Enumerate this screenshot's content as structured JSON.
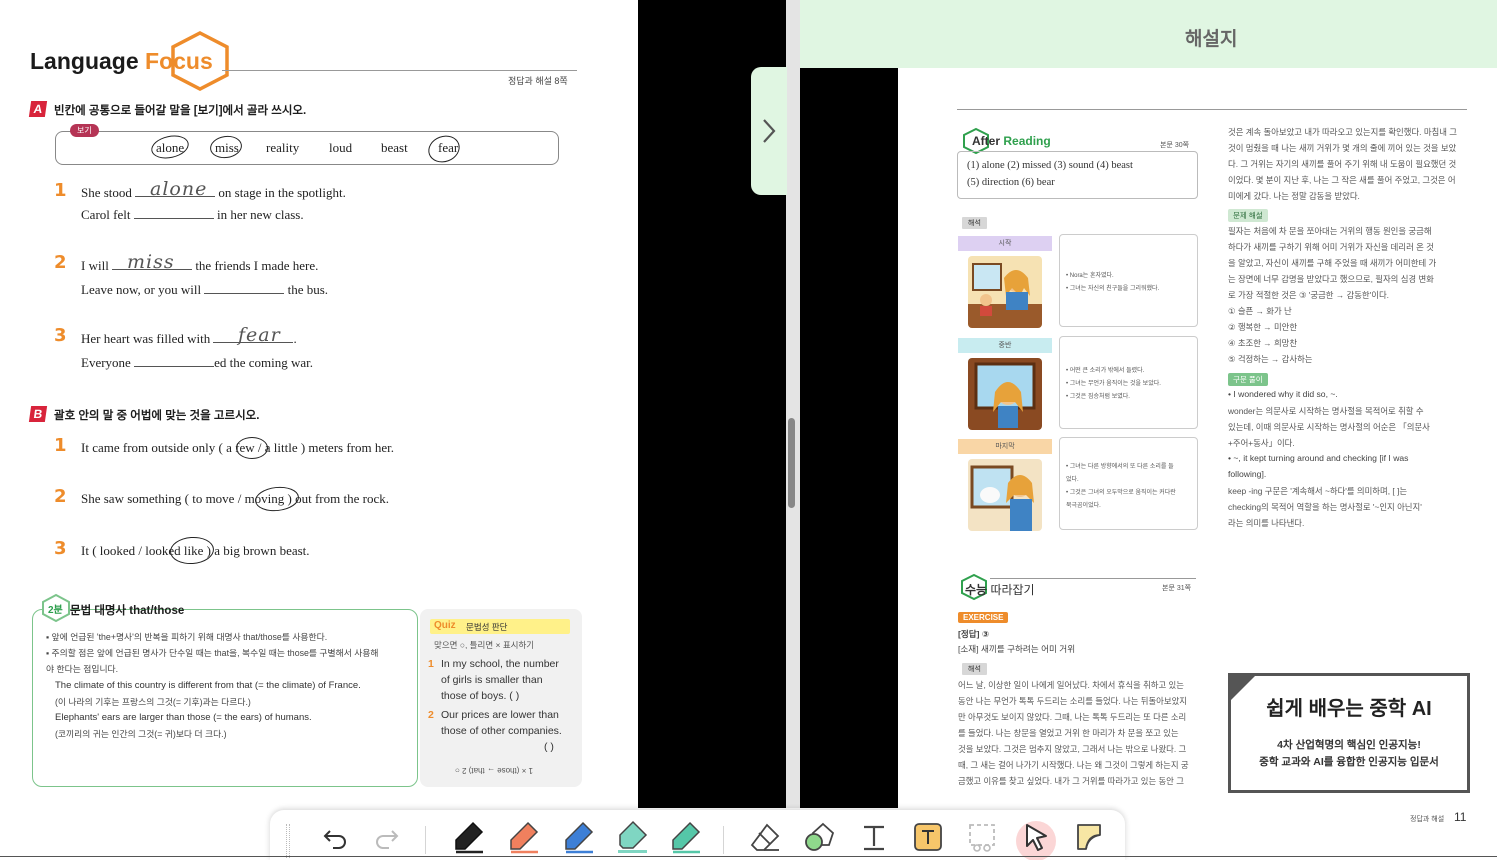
{
  "left_page": {
    "title_word1": "Language",
    "title_word2": "Focus",
    "page_ref": "정답과 해설 8쪽",
    "section_a": {
      "badge": "A",
      "instruction": "빈칸에 공통으로 들어갈 말을 [보기]에서 골라 쓰시오.",
      "word_box_tag": "보기",
      "words": [
        "alone",
        "miss",
        "reality",
        "loud",
        "beast",
        "fear"
      ],
      "questions": [
        {
          "num": "1",
          "line1_pre": "She stood",
          "answer": "alone",
          "line1_post": "on stage in the spotlight.",
          "line2_pre": "Carol felt",
          "line2_post": "in her new class."
        },
        {
          "num": "2",
          "line1_pre": "I will",
          "answer": "miss",
          "line1_post": "the friends I made here.",
          "line2_pre": "Leave now, or you will",
          "line2_post": "the bus."
        },
        {
          "num": "3",
          "line1_pre": "Her heart was filled with",
          "answer": "fear",
          "line1_post": ".",
          "line2_pre": "Everyone",
          "line2_post": "ed the coming war."
        }
      ]
    },
    "section_b": {
      "badge": "B",
      "instruction": "괄호 안의 말 중 어법에 맞는 것을 고르시오.",
      "questions": [
        {
          "num": "1",
          "text": "It came from outside only ( a few / a little ) meters from her."
        },
        {
          "num": "2",
          "text": "She saw something ( to move / moving ) out from the rock."
        },
        {
          "num": "3",
          "text": "It ( looked / looked like ) a big brown beast."
        }
      ]
    },
    "grammar": {
      "num": "2분",
      "title": "문법   대명사 that/those",
      "lines": [
        "▪ 앞에 언급된 'the+명사'의 반복을 피하기 위해 대명사 that/those를 사용한다.",
        "▪ 주의할 점은 앞에 언급된 명사가 단수일 때는 that을, 복수일 때는 those를 구별해서 사용해",
        "   야 한다는 점입니다.",
        "The climate of this country is different from that (= the climate) of France.",
        "(이 나라의 기후는 프랑스의 그것(= 기후)과는 다르다.)",
        "Elephants' ears are larger than those (= the ears) of humans.",
        "(코끼리의 귀는 인간의 그것(= 귀)보다 더 크다.)"
      ]
    },
    "quiz": {
      "label": "Quiz",
      "sub": "문법성 판단",
      "hint": "맞으면 ○, 틀리면 × 표시하기",
      "items": [
        {
          "num": "1",
          "lines": [
            "In my school, the number",
            "of girls is smaller than",
            "those of boys.           (     )"
          ]
        },
        {
          "num": "2",
          "lines": [
            "Our prices are lower than",
            "those of other companies.",
            "(     )"
          ]
        }
      ],
      "answer_upside_down": "1 × (those → that)  2 ○"
    }
  },
  "right_page": {
    "header_title": "해설지",
    "after_reading": {
      "title_a": "After",
      "title_b": "Reading",
      "page_ref": "본문 30쪽",
      "answers_line1": "(1) alone   (2) missed   (3) sound   (4) beast",
      "answers_line2": "(5) direction  (6) bear",
      "tag": "해석",
      "stages": [
        {
          "label": "시작",
          "notes": [
            "• Nora는 혼자였다.",
            "• 그녀는 자신의 친구들을 그리워했다."
          ]
        },
        {
          "label": "중반",
          "notes": [
            "• 어떤 큰 소리가 밖에서 들렸다.",
            "• 그녀는 무언가 움직이는 것을 보았다.",
            "• 그것은 짐승처럼 보였다."
          ]
        },
        {
          "label": "마지막",
          "notes": [
            "• 그녀는 다른 방향에서의 또 다른 소리를 들",
            "  었다.",
            "• 그것은 그녀의 오두막으로 움직이는 커다란",
            "  북극곰이었다."
          ]
        }
      ]
    },
    "suneung": {
      "title_a": "수능",
      "title_b": "따라잡기",
      "page_ref": "본문 31쪽",
      "exercise": "EXERCISE",
      "answer_line": "[정답] ③",
      "topic_line": "[소재] 새끼를 구하려는 어미 거위",
      "tag": "해석",
      "lines": [
        "어느 날, 이상한 일이 나에게 일어났다. 차에서 휴식을 취하고 있는",
        "동안 나는 무언가 톡톡 두드리는 소리를 들었다. 나는 뒤돌아보았지",
        "만 아무것도 보이지 않았다. 그때, 나는 톡톡 두드리는 또 다른 소리",
        "를 들었다. 나는 창문을 열었고 거위 한 마리가 차 문을 쪼고 있는",
        "것을 보았다. 그것은 멈추지 않았고, 그래서 나는 밖으로 나왔다. 그",
        "때, 그 새는 걸어 나가기 시작했다. 나는 왜 그것이 그렇게 하는지 궁",
        "금했고 이유를 찾고 싶었다. 내가 그 거위를 따라가고 있는 동안 그"
      ]
    },
    "column2": {
      "lines_top": [
        "것은 계속 돌아보았고 내가 따라오고 있는지를 확인했다. 마침내 그",
        "것이 멈췄을 때 나는 새끼 거위가 몇 개의 줄에 끼어 있는 것을 보았",
        "다. 그 거위는 자기의 새끼를 풀어 주기 위해 내 도움이 필요했던 것",
        "이었다. 몇 분이 지난 후, 나는 그 작은 새를 풀어 주었고, 그것은 어",
        "미에게 갔다. 나는 정말 감동을 받았다."
      ],
      "tag_problem": "문제 해설",
      "lines_problem": [
        "필자는 처음에 차 문을 쪼아대는 거위의 행동 원인을 궁금해",
        "하다가 새끼를 구하기 위해 어미 거위가 자신을 데리러 온 것",
        "을 알았고, 자신이 새끼를 구해 주었을 때 새끼가 어미한테 가",
        "는 장면에 너무 감명을 받았다고 했으므로, 필자의 심경 변화",
        "로 가장 적절한 것은 ③ '궁금한 → 감동한'이다.",
        "① 슬픈 → 화가 난",
        "② 행복한 → 미안한",
        "④ 초조한 → 희망찬",
        "⑤ 걱정하는 → 감사하는"
      ],
      "tag_syntax_a": "구문",
      "tag_syntax_b": "풀이",
      "lines_syntax": [
        "• I wondered why it did so, ~.",
        "  wonder는 의문사로 시작하는 명사절을 목적어로 취할 수",
        "  있는데, 이때 의문사로 시작하는 명사절의 어순은 「의문사",
        "  +주어+동사」이다.",
        "• ~, it kept turning around and checking [if I was",
        "  following].",
        "  keep -ing 구문은 '계속해서 ~하다'를 의미하며, [  ]는",
        "  checking의 목적어 역할을 하는 명사절로 '~인지 아닌지'",
        "  라는 의미를 나타낸다."
      ]
    },
    "ad": {
      "title": "쉽게 배우는 중학 AI",
      "sub1": "4차 산업혁명의 핵심인 인공지능!",
      "sub2": "중학 교과와 AI를 융합한 인공지능 입문서"
    },
    "footer_label": "정답과 해설",
    "page_number": "11"
  },
  "toolbar": {
    "tools": [
      "undo-icon",
      "redo-icon",
      "pen-black-icon",
      "pen-orange-icon",
      "pen-blue-icon",
      "highlighter-teal-icon",
      "pen-teal-icon",
      "eraser-icon",
      "shapes-icon",
      "text-icon",
      "text-box-icon",
      "lasso-icon",
      "pointer-icon",
      "sticky-note-icon"
    ],
    "active_tool": "pointer-icon"
  },
  "colors": {
    "accent_orange": "#ee8c2b",
    "section_red": "#d8243b",
    "header_green": "#e0f6e2",
    "grammar_green": "#7cc48b",
    "active_tool_pink": "#fbd6d6"
  }
}
